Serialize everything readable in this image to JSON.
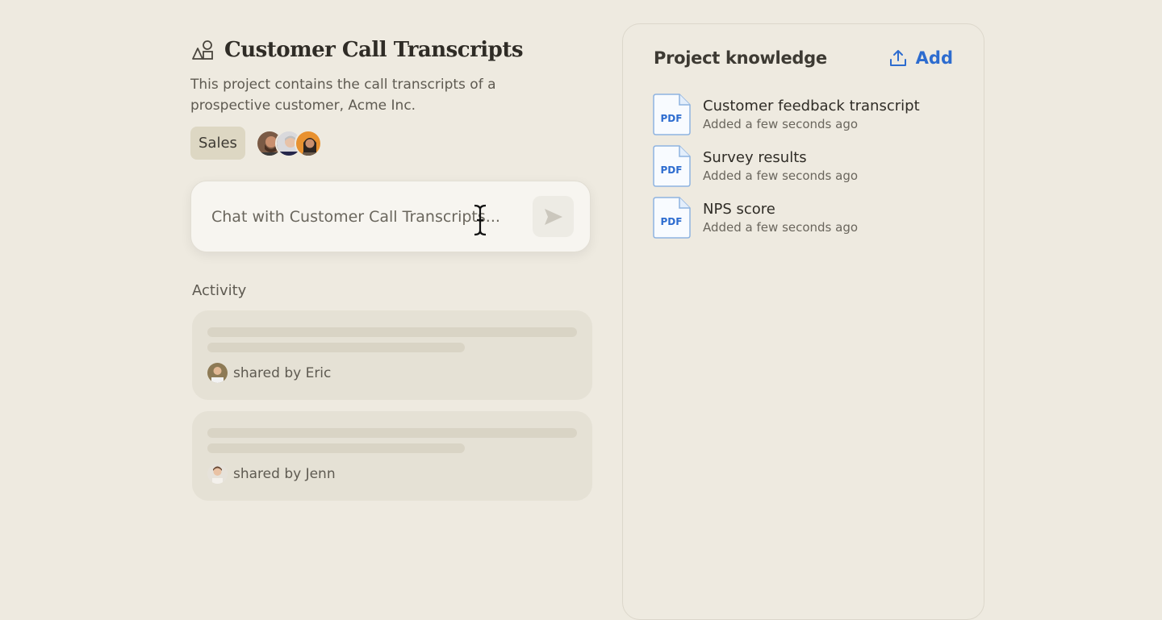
{
  "project": {
    "title": "Customer Call Transcripts",
    "description": "This project contains the call transcripts of a prospective customer, Acme Inc.",
    "tag": "Sales",
    "member_avatars": [
      "avatar-man-beard",
      "avatar-man-glasses",
      "avatar-woman-dark-hair"
    ]
  },
  "chat": {
    "placeholder": "Chat with Customer Call Transcripts..."
  },
  "activity": {
    "label": "Activity",
    "items": [
      {
        "shared_by": "shared by Eric"
      },
      {
        "shared_by": "shared by Jenn"
      }
    ]
  },
  "knowledge": {
    "title": "Project knowledge",
    "add_label": "Add",
    "files": [
      {
        "name": "Customer feedback transcript",
        "subtitle": "Added a few seconds ago",
        "type": "PDF"
      },
      {
        "name": "Survey results",
        "subtitle": "Added a few seconds ago",
        "type": "PDF"
      },
      {
        "name": "NPS score",
        "subtitle": "Added a few seconds ago",
        "type": "PDF"
      }
    ]
  },
  "colors": {
    "background": "#eeeae0",
    "accent": "#2d6ccf",
    "tag_bg": "#ddd7c3"
  }
}
